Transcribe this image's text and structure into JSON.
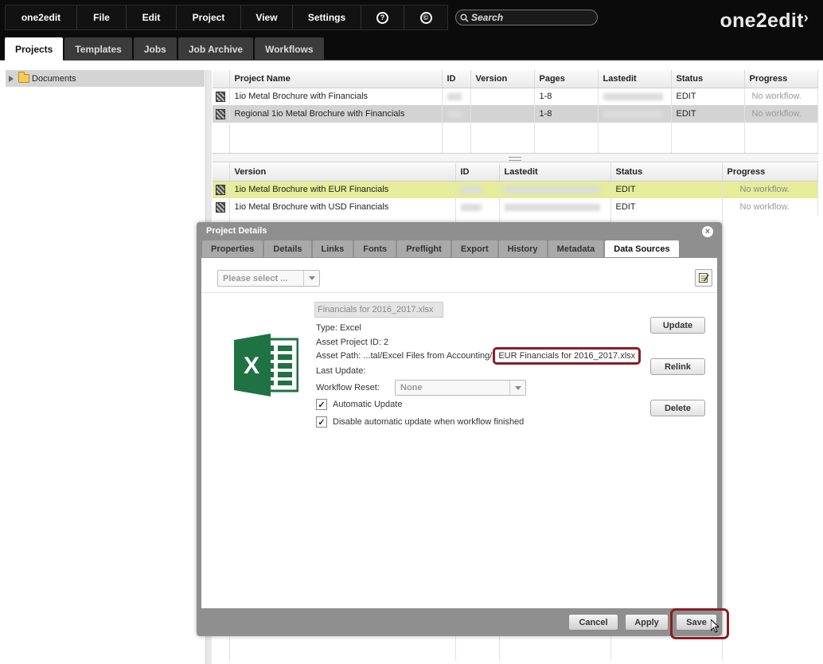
{
  "app": {
    "menu": [
      "one2edit",
      "File",
      "Edit",
      "Project",
      "View",
      "Settings"
    ],
    "help_icon_glyph": "?",
    "copyright_icon_glyph": "©",
    "search_placeholder": "Search",
    "logo": "one2edit"
  },
  "tabs": [
    "Projects",
    "Templates",
    "Jobs",
    "Job Archive",
    "Workflows"
  ],
  "active_tab": "Projects",
  "tree": {
    "root": "Documents"
  },
  "projects_table": {
    "headers": [
      "Project Name",
      "ID",
      "Version",
      "Pages",
      "Lastedit",
      "Status",
      "Progress"
    ],
    "rows": [
      {
        "name": "1io Metal Brochure with Financials",
        "pages": "1-8",
        "status": "EDIT",
        "progress": "No workflow."
      },
      {
        "name": "Regional 1io Metal Brochure with Financials",
        "pages": "1-8",
        "status": "EDIT",
        "progress": "No workflow."
      }
    ]
  },
  "versions_table": {
    "headers": [
      "Version",
      "ID",
      "Lastedit",
      "Status",
      "Progress"
    ],
    "rows": [
      {
        "name": "1io Metal Brochure with EUR Financials",
        "status": "EDIT",
        "progress": "No workflow."
      },
      {
        "name": "1io Metal Brochure with USD Financials",
        "status": "EDIT",
        "progress": "No workflow."
      }
    ]
  },
  "dialog": {
    "title": "Project Details",
    "close_glyph": "×",
    "tabs": [
      "Properties",
      "Details",
      "Links",
      "Fonts",
      "Preflight",
      "Export",
      "History",
      "Metadata",
      "Data Sources"
    ],
    "active_tab": "Data Sources",
    "select_placeholder": "Please select ...",
    "file_name": "Financials for 2016_2017.xlsx",
    "type_label": "Type: Excel",
    "asset_project_id": "Asset Project ID: 2",
    "asset_path_prefix": "Asset Path: ...tal/Excel Files from Accounting/",
    "asset_path_file": "EUR Financials for 2016_2017.xlsx",
    "last_update": "Last Update:",
    "workflow_reset_label": "Workflow Reset:",
    "workflow_reset_value": "None",
    "automatic_update": {
      "label": "Automatic Update",
      "checked": true
    },
    "disable_auto_update": {
      "label": "Disable automatic update when workflow finished",
      "checked": true
    },
    "buttons": {
      "update": "Update",
      "relink": "Relink",
      "delete": "Delete"
    },
    "footer": {
      "cancel": "Cancel",
      "apply": "Apply",
      "save": "Save"
    },
    "excel_icon": "excel-icon"
  },
  "colors": {
    "highlight_border": "#8b1d24",
    "excel_green": "#1f7244",
    "selected_row": "#e5ec9a"
  }
}
